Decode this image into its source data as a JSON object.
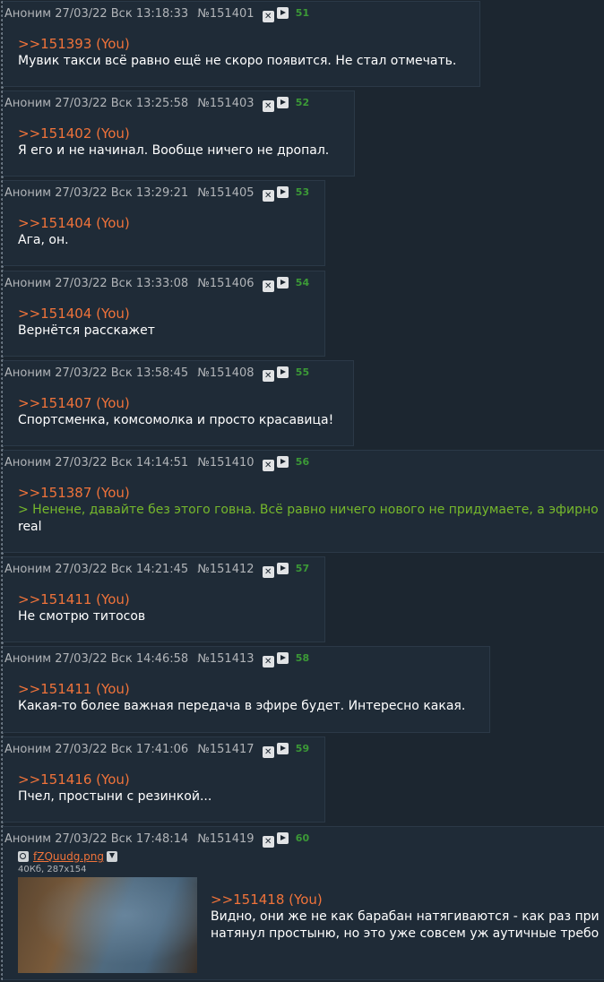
{
  "posts": [
    {
      "author": "Аноним",
      "date": "27/03/22 Вск 13:18:33",
      "num": "№151401",
      "count": "51",
      "reply": ">>151393 (You)",
      "lines": [
        "Мувик такси всё равно ещё не скоро появится. Не стал отмечать."
      ]
    },
    {
      "author": "Аноним",
      "date": "27/03/22 Вск 13:25:58",
      "num": "№151403",
      "count": "52",
      "reply": ">>151402 (You)",
      "lines": [
        "Я его и не начинал. Вообще ничего не дропал."
      ]
    },
    {
      "author": "Аноним",
      "date": "27/03/22 Вск 13:29:21",
      "num": "№151405",
      "count": "53",
      "reply": ">>151404 (You)",
      "lines": [
        "Ага, он."
      ]
    },
    {
      "author": "Аноним",
      "date": "27/03/22 Вск 13:33:08",
      "num": "№151406",
      "count": "54",
      "reply": ">>151404 (You)",
      "lines": [
        "Вернётся расскажет"
      ]
    },
    {
      "author": "Аноним",
      "date": "27/03/22 Вск 13:58:45",
      "num": "№151408",
      "count": "55",
      "reply": ">>151407 (You)",
      "lines": [
        "Спортсменка, комсомолка и просто красавица!"
      ]
    },
    {
      "author": "Аноним",
      "date": "27/03/22 Вск 14:14:51",
      "num": "№151410",
      "count": "56",
      "reply": ">>151387 (You)",
      "quote": "> Ненене, давайте без этого говна. Всё равно ничего нового не придумаете, а эфирно",
      "lines": [
        "real"
      ]
    },
    {
      "author": "Аноним",
      "date": "27/03/22 Вск 14:21:45",
      "num": "№151412",
      "count": "57",
      "reply": ">>151411 (You)",
      "lines": [
        "Не смотрю титосов"
      ]
    },
    {
      "author": "Аноним",
      "date": "27/03/22 Вск 14:46:58",
      "num": "№151413",
      "count": "58",
      "reply": ">>151411 (You)",
      "lines": [
        "Какая-то более важная передача в эфире будет. Интересно какая."
      ]
    },
    {
      "author": "Аноним",
      "date": "27/03/22 Вск 17:41:06",
      "num": "№151417",
      "count": "59",
      "reply": ">>151416 (You)",
      "lines": [
        "Пчел, простыни с резинкой..."
      ]
    },
    {
      "author": "Аноним",
      "date": "27/03/22 Вск 17:48:14",
      "num": "№151419",
      "count": "60",
      "reply": ">>151418 (You)",
      "lines": [
        "Видно, они же не как барабан натягиваются - как раз при",
        "натянул простыню, но это уже совсем уж аутичные требо"
      ],
      "file": {
        "name": "fZQuudg.png",
        "meta": "40Кб, 287x154"
      }
    }
  ],
  "colors": {
    "background": "#1c2630",
    "post": "#1f2b37",
    "reply": "#f0733a",
    "quote": "#76b82c",
    "counter": "#3c9a37"
  },
  "icons": {
    "hide": "close-icon",
    "play": "play-icon",
    "search": "search-icon",
    "download": "download-icon"
  }
}
